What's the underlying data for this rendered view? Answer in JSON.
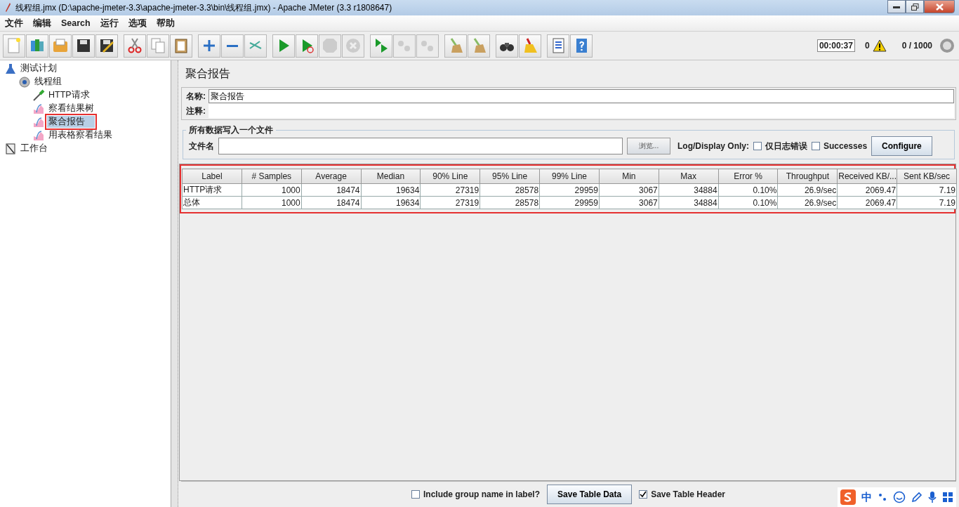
{
  "window": {
    "title": "线程组.jmx (D:\\apache-jmeter-3.3\\apache-jmeter-3.3\\bin\\线程组.jmx) - Apache JMeter (3.3 r1808647)"
  },
  "menu": [
    "文件",
    "编辑",
    "Search",
    "运行",
    "选项",
    "帮助"
  ],
  "toolbar": [
    {
      "disabled": false
    },
    {
      "disabled": false
    },
    {
      "disabled": false
    },
    {
      "disabled": false
    },
    {
      "disabled": false
    },
    {
      "disabled": false
    },
    {
      "disabled": false
    },
    {
      "disabled": false
    },
    {
      "disabled": false
    },
    {
      "disabled": false
    },
    {
      "disabled": false
    },
    {
      "disabled": false
    },
    {
      "disabled": false
    },
    {
      "disabled": true
    },
    {
      "disabled": true
    },
    {
      "disabled": false
    },
    {
      "disabled": true
    },
    {
      "disabled": true
    },
    {
      "disabled": false
    },
    {
      "disabled": false
    },
    {
      "disabled": false
    },
    {
      "disabled": false
    },
    {
      "disabled": false
    },
    {
      "disabled": false
    }
  ],
  "status": {
    "timer": "00:00:37",
    "warnings": "0",
    "threads": "0 / 1000"
  },
  "tree": [
    {
      "label": "测试计划",
      "kind": "plan",
      "selected": false,
      "children": [
        {
          "label": "线程组",
          "kind": "group",
          "selected": false,
          "children": [
            {
              "label": "HTTP请求",
              "kind": "sampler",
              "selected": false
            },
            {
              "label": "察看结果树",
              "kind": "listener",
              "selected": false
            },
            {
              "label": "聚合报告",
              "kind": "listener",
              "selected": true
            },
            {
              "label": "用表格察看结果",
              "kind": "listener",
              "selected": false
            }
          ]
        }
      ]
    },
    {
      "label": "工作台",
      "kind": "workbench",
      "selected": false
    }
  ],
  "panel": {
    "title": "聚合报告",
    "name_label": "名称:",
    "name_value": "聚合报告",
    "comment_label": "注释:",
    "file_group": "所有数据写入一个文件",
    "file_label": "文件名",
    "browse": "浏览...",
    "log_label": "Log/Display Only:",
    "options": [
      {
        "label": "仅日志错误",
        "checked": false
      },
      {
        "label": "Successes",
        "checked": false
      }
    ],
    "configure": "Configure"
  },
  "table": {
    "columns": [
      "Label",
      "# Samples",
      "Average",
      "Median",
      "90% Line",
      "95% Line",
      "99% Line",
      "Min",
      "Max",
      "Error %",
      "Throughput",
      "Received KB/...",
      "Sent KB/sec"
    ],
    "rows": [
      [
        "HTTP请求",
        "1000",
        "18474",
        "19634",
        "27319",
        "28578",
        "29959",
        "3067",
        "34884",
        "0.10%",
        "26.9/sec",
        "2069.47",
        "7.19"
      ],
      [
        "总体",
        "1000",
        "18474",
        "19634",
        "27319",
        "28578",
        "29959",
        "3067",
        "34884",
        "0.10%",
        "26.9/sec",
        "2069.47",
        "7.19"
      ]
    ]
  },
  "bottom": {
    "include_group": {
      "label": "Include group name in label?",
      "checked": false
    },
    "save_data": "Save Table Data",
    "save_header": {
      "label": "Save Table Header",
      "checked": true
    }
  },
  "ime": {
    "mode": "中"
  }
}
